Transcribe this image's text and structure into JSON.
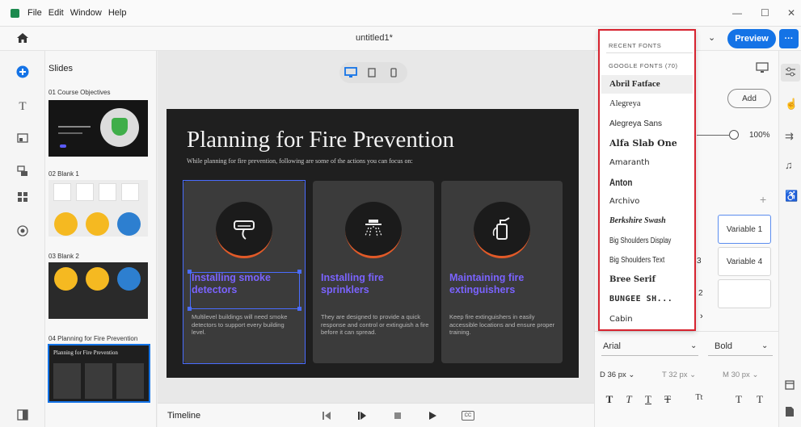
{
  "menubar": {
    "items": [
      "File",
      "Edit",
      "Window",
      "Help"
    ]
  },
  "window_controls": {
    "minimize": "—",
    "maximize": "☐",
    "close": "✕"
  },
  "header": {
    "doc_title": "untitled1*",
    "preview_label": "Preview",
    "more_label": "···"
  },
  "slides_panel": {
    "title": "Slides",
    "slides": [
      {
        "label": "01 Course Objectives"
      },
      {
        "label": "02 Blank 1"
      },
      {
        "label": "03 Blank 2"
      },
      {
        "label": "04 Planning for Fire Prevention",
        "thumb_title": "Planning for Fire Prevention"
      }
    ]
  },
  "slide": {
    "title": "Planning for Fire Prevention",
    "subtitle": "While planning for fire prevention, following are some of the actions you can focus on:",
    "cards": [
      {
        "title": "Installing smoke detectors",
        "body": "Multilevel buildings will need smoke detectors to support every building level.",
        "icon": "smoke-detector-icon"
      },
      {
        "title": "Installing fire sprinklers",
        "body": "They are designed to provide a quick response and control or extinguish a fire before it can spread.",
        "icon": "sprinkler-icon"
      },
      {
        "title": "Maintaining fire extinguishers",
        "body": "Keep fire extinguishers in easily accessible locations and ensure proper training.",
        "icon": "extinguisher-icon"
      }
    ],
    "accent_color": "#7a63ff",
    "ring_color": "#e25a28"
  },
  "timeline": {
    "label": "Timeline",
    "cc_label": "CC"
  },
  "font_menu": {
    "recent_heading": "RECENT FONTS",
    "google_heading": "GOOGLE FONTS (70)",
    "fonts": [
      "Abril Fatface",
      "Alegreya",
      "Alegreya Sans",
      "Alfa Slab One",
      "Amaranth",
      "Anton",
      "Archivo",
      "Berkshire Swash",
      "Big Shoulders Display",
      "Big Shoulders Text",
      "Bree Serif",
      "BUNGEE SH...",
      "Cabin"
    ]
  },
  "properties": {
    "add_label": "Add",
    "opacity_value": "100%",
    "variables": [
      "Variable 1",
      "Variable 4"
    ],
    "partial_nums": [
      "3",
      "2"
    ],
    "font_family": "Arial",
    "font_weight": "Bold",
    "size_label_d": "D",
    "size_d": "36 px",
    "size_label_t": "T",
    "size_t": "32 px",
    "size_label_m": "M",
    "size_m": "30 px",
    "format_buttons": [
      "T",
      "T",
      "T",
      "T",
      "Tt",
      "T",
      "T"
    ]
  }
}
